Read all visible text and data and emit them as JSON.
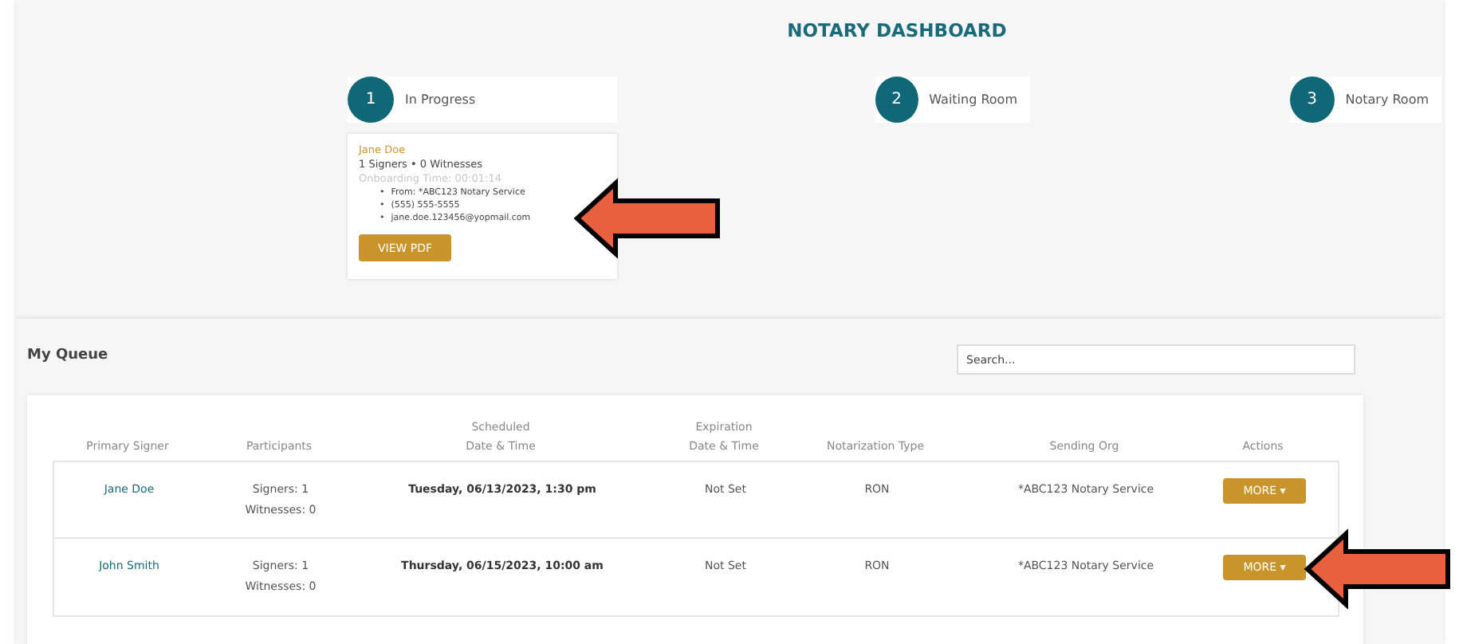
{
  "title": "NOTARY DASHBOARD",
  "steps": [
    {
      "number": "1",
      "label": "In Progress"
    },
    {
      "number": "2",
      "label": "Waiting Room"
    },
    {
      "number": "3",
      "label": "Notary Room"
    }
  ],
  "in_progress_card": {
    "name": "Jane Doe",
    "participants": "1 Signers • 0 Witnesses",
    "onboarding_time": "Onboarding Time: 00:01:14",
    "details": [
      {
        "bullet": "•",
        "text": "From: *ABC123 Notary Service"
      },
      {
        "bullet": "•",
        "text": "(555) 555-5555"
      },
      {
        "bullet": "•",
        "text": "jane.doe.123456@yopmail.com"
      }
    ],
    "button": "VIEW PDF"
  },
  "queue": {
    "title": "My Queue",
    "search": {
      "placeholder": "Search..."
    },
    "columns": [
      "Primary Signer",
      "Participants",
      "Scheduled\nDate & Time",
      "Expiration\nDate & Time",
      "Notarization Type",
      "Sending Org",
      "Actions"
    ],
    "rows": [
      {
        "primary_signer": "Jane Doe",
        "participants": [
          "Signers: 1",
          "Witnesses: 0"
        ],
        "scheduled": "Tuesday, 06/13/2023, 1:30 pm",
        "expiration": "Not Set",
        "type": "RON",
        "sending_org": "*ABC123 Notary Service",
        "action": "MORE ▾"
      },
      {
        "primary_signer": "John Smith",
        "participants": [
          "Signers: 1",
          "Witnesses: 0"
        ],
        "scheduled": "Thursday, 06/15/2023, 10:00 am",
        "expiration": "Not Set",
        "type": "RON",
        "sending_org": "*ABC123 Notary Service",
        "action": "MORE ▾"
      }
    ]
  },
  "annotation_arrows": [
    {
      "kind": "arrow"
    },
    {
      "kind": "arrow"
    }
  ]
}
